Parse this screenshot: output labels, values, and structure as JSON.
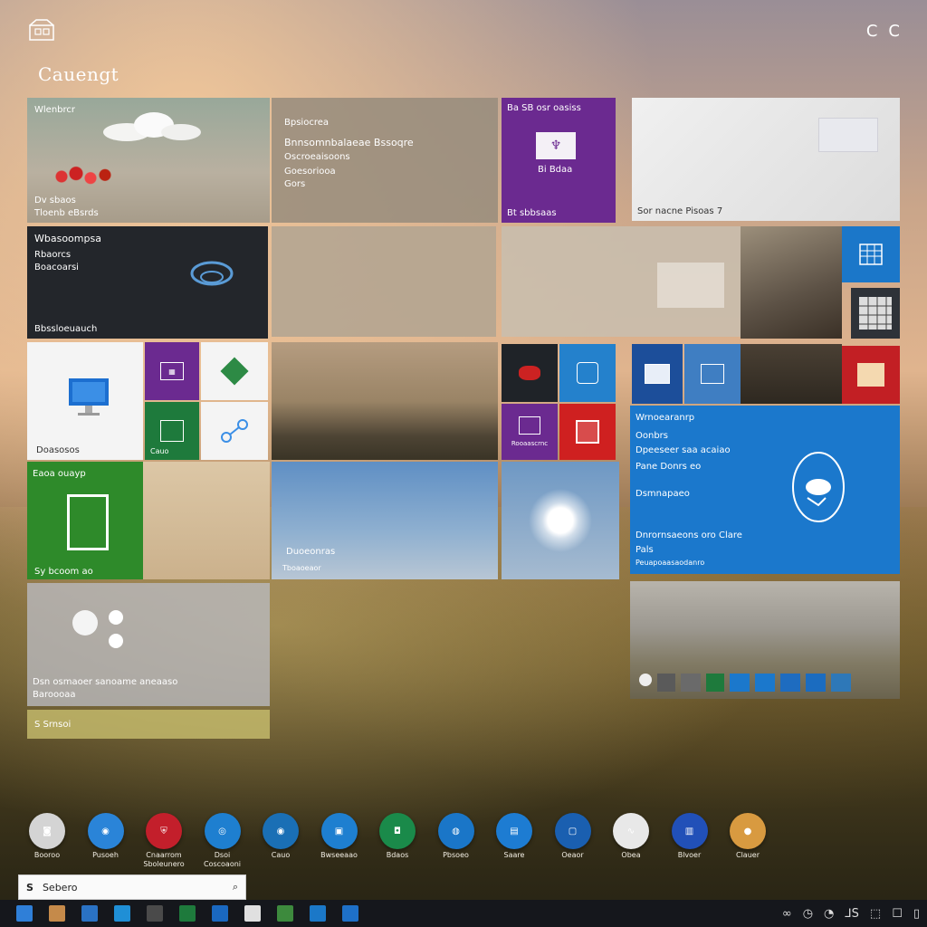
{
  "window": {
    "title": "Cauengt",
    "controls": [
      "C",
      "C"
    ]
  },
  "tiles": {
    "weather": {
      "title": "Wlenbrcr",
      "lines": [
        "",
        "",
        ""
      ],
      "foot": "Dv sbaos",
      "foot2": "Tloenb eBsrds"
    },
    "news": {
      "line1": "Bpsiocrea",
      "line2": "Bnnsomnbalaeae Bssoqre",
      "line3": "Oscroeaisoons",
      "line4": "Goesoriooa",
      "line5": "Gors"
    },
    "store": {
      "title": "Ba SB osr oasiss",
      "label": "Bi Bdaa",
      "foot": "Bt sbbsaas"
    },
    "photo": {
      "label": "Sor nacne Pisoas 7"
    },
    "edge": {
      "title": "Wbasoompsa",
      "line2": "Rbaorcs",
      "line3": "Boacoarsi",
      "foot": "Bbssloeuauch"
    },
    "small_mail": {
      "label": "Doasosos"
    },
    "small_cal": {
      "label": "Cauo"
    },
    "xbox": {
      "label": "Rooaascrnc"
    },
    "green_tile": {
      "title": "Eaoa ouayp",
      "foot": "Sy bcoom ao"
    },
    "sky": {
      "label": "Duoeonras",
      "foot": "Tboaoeaor"
    },
    "people": {
      "title": "Wrnoearanrp",
      "l1": "Oonbrs",
      "l2": "Dpeeseer saa acaiao",
      "l3": "Pane Donrs eo",
      "l4": "Dsmnapaeo",
      "l5": "Dnrornsaeons oro Clare",
      "l6": "Pals",
      "l7": "Peuapoaasaodanro"
    },
    "moon": {
      "label": "Dsn osmaoer sanoame aneaaso",
      "label2": "Baroooaa"
    },
    "yellow_bar": {
      "label": "S Srnsoi"
    }
  },
  "dock": [
    {
      "label": "Booroo",
      "color": "#d4d4d4",
      "icon": "camera-icon"
    },
    {
      "label": "Pusoeh",
      "color": "#2a84d8",
      "icon": "globe-icon"
    },
    {
      "label": "Cnaarrom Sboleunero",
      "color": "#c31f2b",
      "icon": "shield-icon"
    },
    {
      "label": "Dsoi Coscoaoni",
      "color": "#1e7fd0",
      "icon": "web-icon"
    },
    {
      "label": "Cauo",
      "color": "#1a6fb5",
      "icon": "globe-icon"
    },
    {
      "label": "Bwseeaao",
      "color": "#1e7fd0",
      "icon": "folder-icon"
    },
    {
      "label": "Bdaos",
      "color": "#1a8a4a",
      "icon": "bag-icon"
    },
    {
      "label": "Pbsoeo",
      "color": "#1a76c8",
      "icon": "disc-icon"
    },
    {
      "label": "Saare",
      "color": "#1d7cd2",
      "icon": "app-icon"
    },
    {
      "label": "Oeaor",
      "color": "#1a5fb0",
      "icon": "pc-icon"
    },
    {
      "label": "Obea",
      "color": "#e8e8e8",
      "icon": "wave-icon"
    },
    {
      "label": "Blvoer",
      "color": "#2150b8",
      "icon": "book-icon"
    },
    {
      "label": "Clauer",
      "color": "#d89a40",
      "icon": "orb-icon"
    }
  ],
  "search": {
    "prefix": "S",
    "placeholder": "Sebero"
  },
  "taskbar": {
    "icons": [
      "#2f7fd8",
      "#c58a4a",
      "#2a72c4",
      "#1f8fd6",
      "#4a4a4a",
      "#1e7a3c",
      "#1a68c0",
      "#e0e0e0",
      "#3d8a3d",
      "#1b78c8",
      "#1e70c8"
    ],
    "tray": [
      "∞",
      "◷",
      "◔",
      "⅃S",
      "⬚",
      "☐",
      "▯"
    ]
  }
}
